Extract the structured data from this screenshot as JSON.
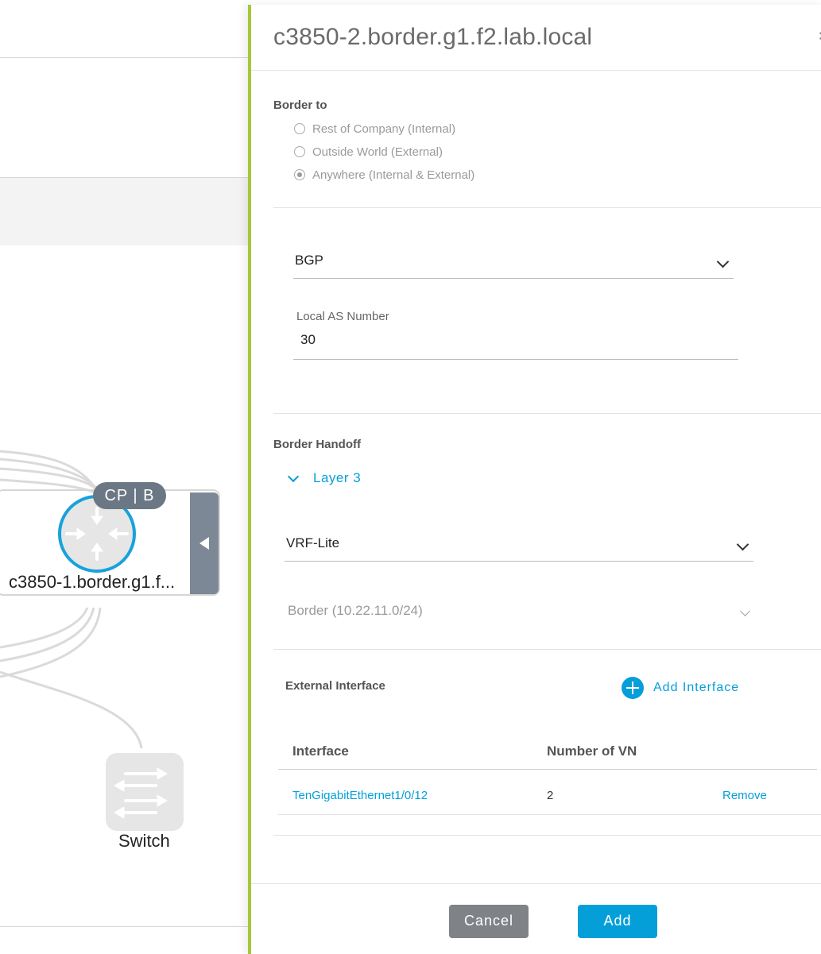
{
  "background": {
    "node_border": {
      "label": "c3850-1.border.g1.f...",
      "badge": "CP | B",
      "icon": "router-icon"
    },
    "node_switch": {
      "label": "Switch",
      "icon": "switch-icon"
    },
    "collapse_icon": "caret-left-icon"
  },
  "panel": {
    "title": "c3850-2.border.g1.f2.lab.local",
    "close_icon": "close-icon",
    "border_to": {
      "label": "Border to",
      "options": [
        {
          "label": "Rest of Company (Internal)",
          "checked": false
        },
        {
          "label": "Outside World (External)",
          "checked": false
        },
        {
          "label": "Anywhere (Internal & External)",
          "checked": true
        }
      ]
    },
    "routing_protocol": {
      "value": "BGP"
    },
    "local_as": {
      "label": "Local AS Number",
      "value": "30"
    },
    "border_handoff": {
      "label": "Border Handoff",
      "layer_label": "Layer 3",
      "handoff_type": {
        "value": "VRF-Lite"
      },
      "border_pool": {
        "value": "Border (10.22.11.0/24)"
      }
    },
    "external_interface": {
      "label": "External Interface",
      "add_label": "Add Interface",
      "columns": [
        "Interface",
        "Number of VN"
      ],
      "rows": [
        {
          "interface": "TenGigabitEthernet1/0/12",
          "vn_count": "2",
          "action": "Remove"
        }
      ]
    },
    "footer": {
      "cancel_label": "Cancel",
      "add_label": "Add"
    }
  },
  "colors": {
    "accent": "#049fd9",
    "panel_border": "#a6c839",
    "badge": "#6b7784",
    "cancel_button": "#7f8387"
  }
}
